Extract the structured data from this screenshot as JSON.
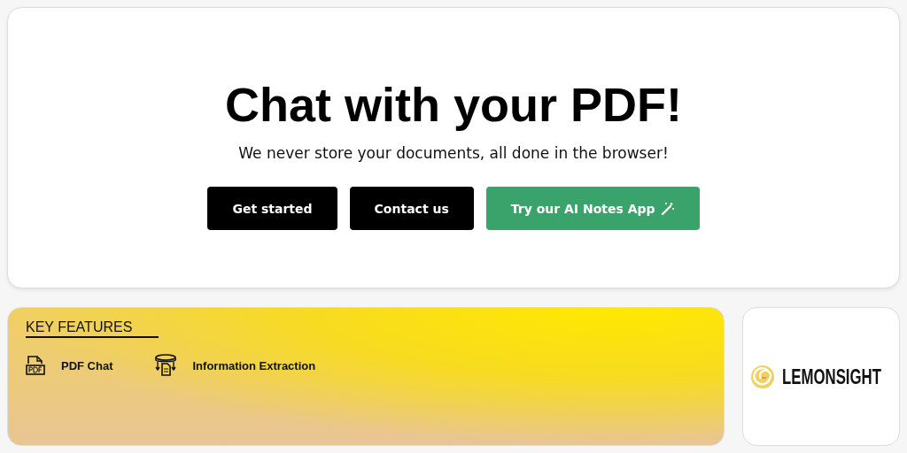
{
  "hero": {
    "title": "Chat with your PDF!",
    "subtitle": "We never store your documents, all done in the browser!",
    "buttons": [
      {
        "label": "Get started",
        "kind": "dark"
      },
      {
        "label": "Contact us",
        "kind": "dark"
      },
      {
        "label": "Try our AI Notes App",
        "kind": "accent"
      }
    ]
  },
  "features": {
    "heading": "KEY FEATURES",
    "items": [
      {
        "label": "PDF Chat",
        "kind": "pdf"
      },
      {
        "label": "Information Extraction",
        "kind": "extraction"
      }
    ]
  },
  "logo": {
    "name": "LEMONSIGHT"
  }
}
